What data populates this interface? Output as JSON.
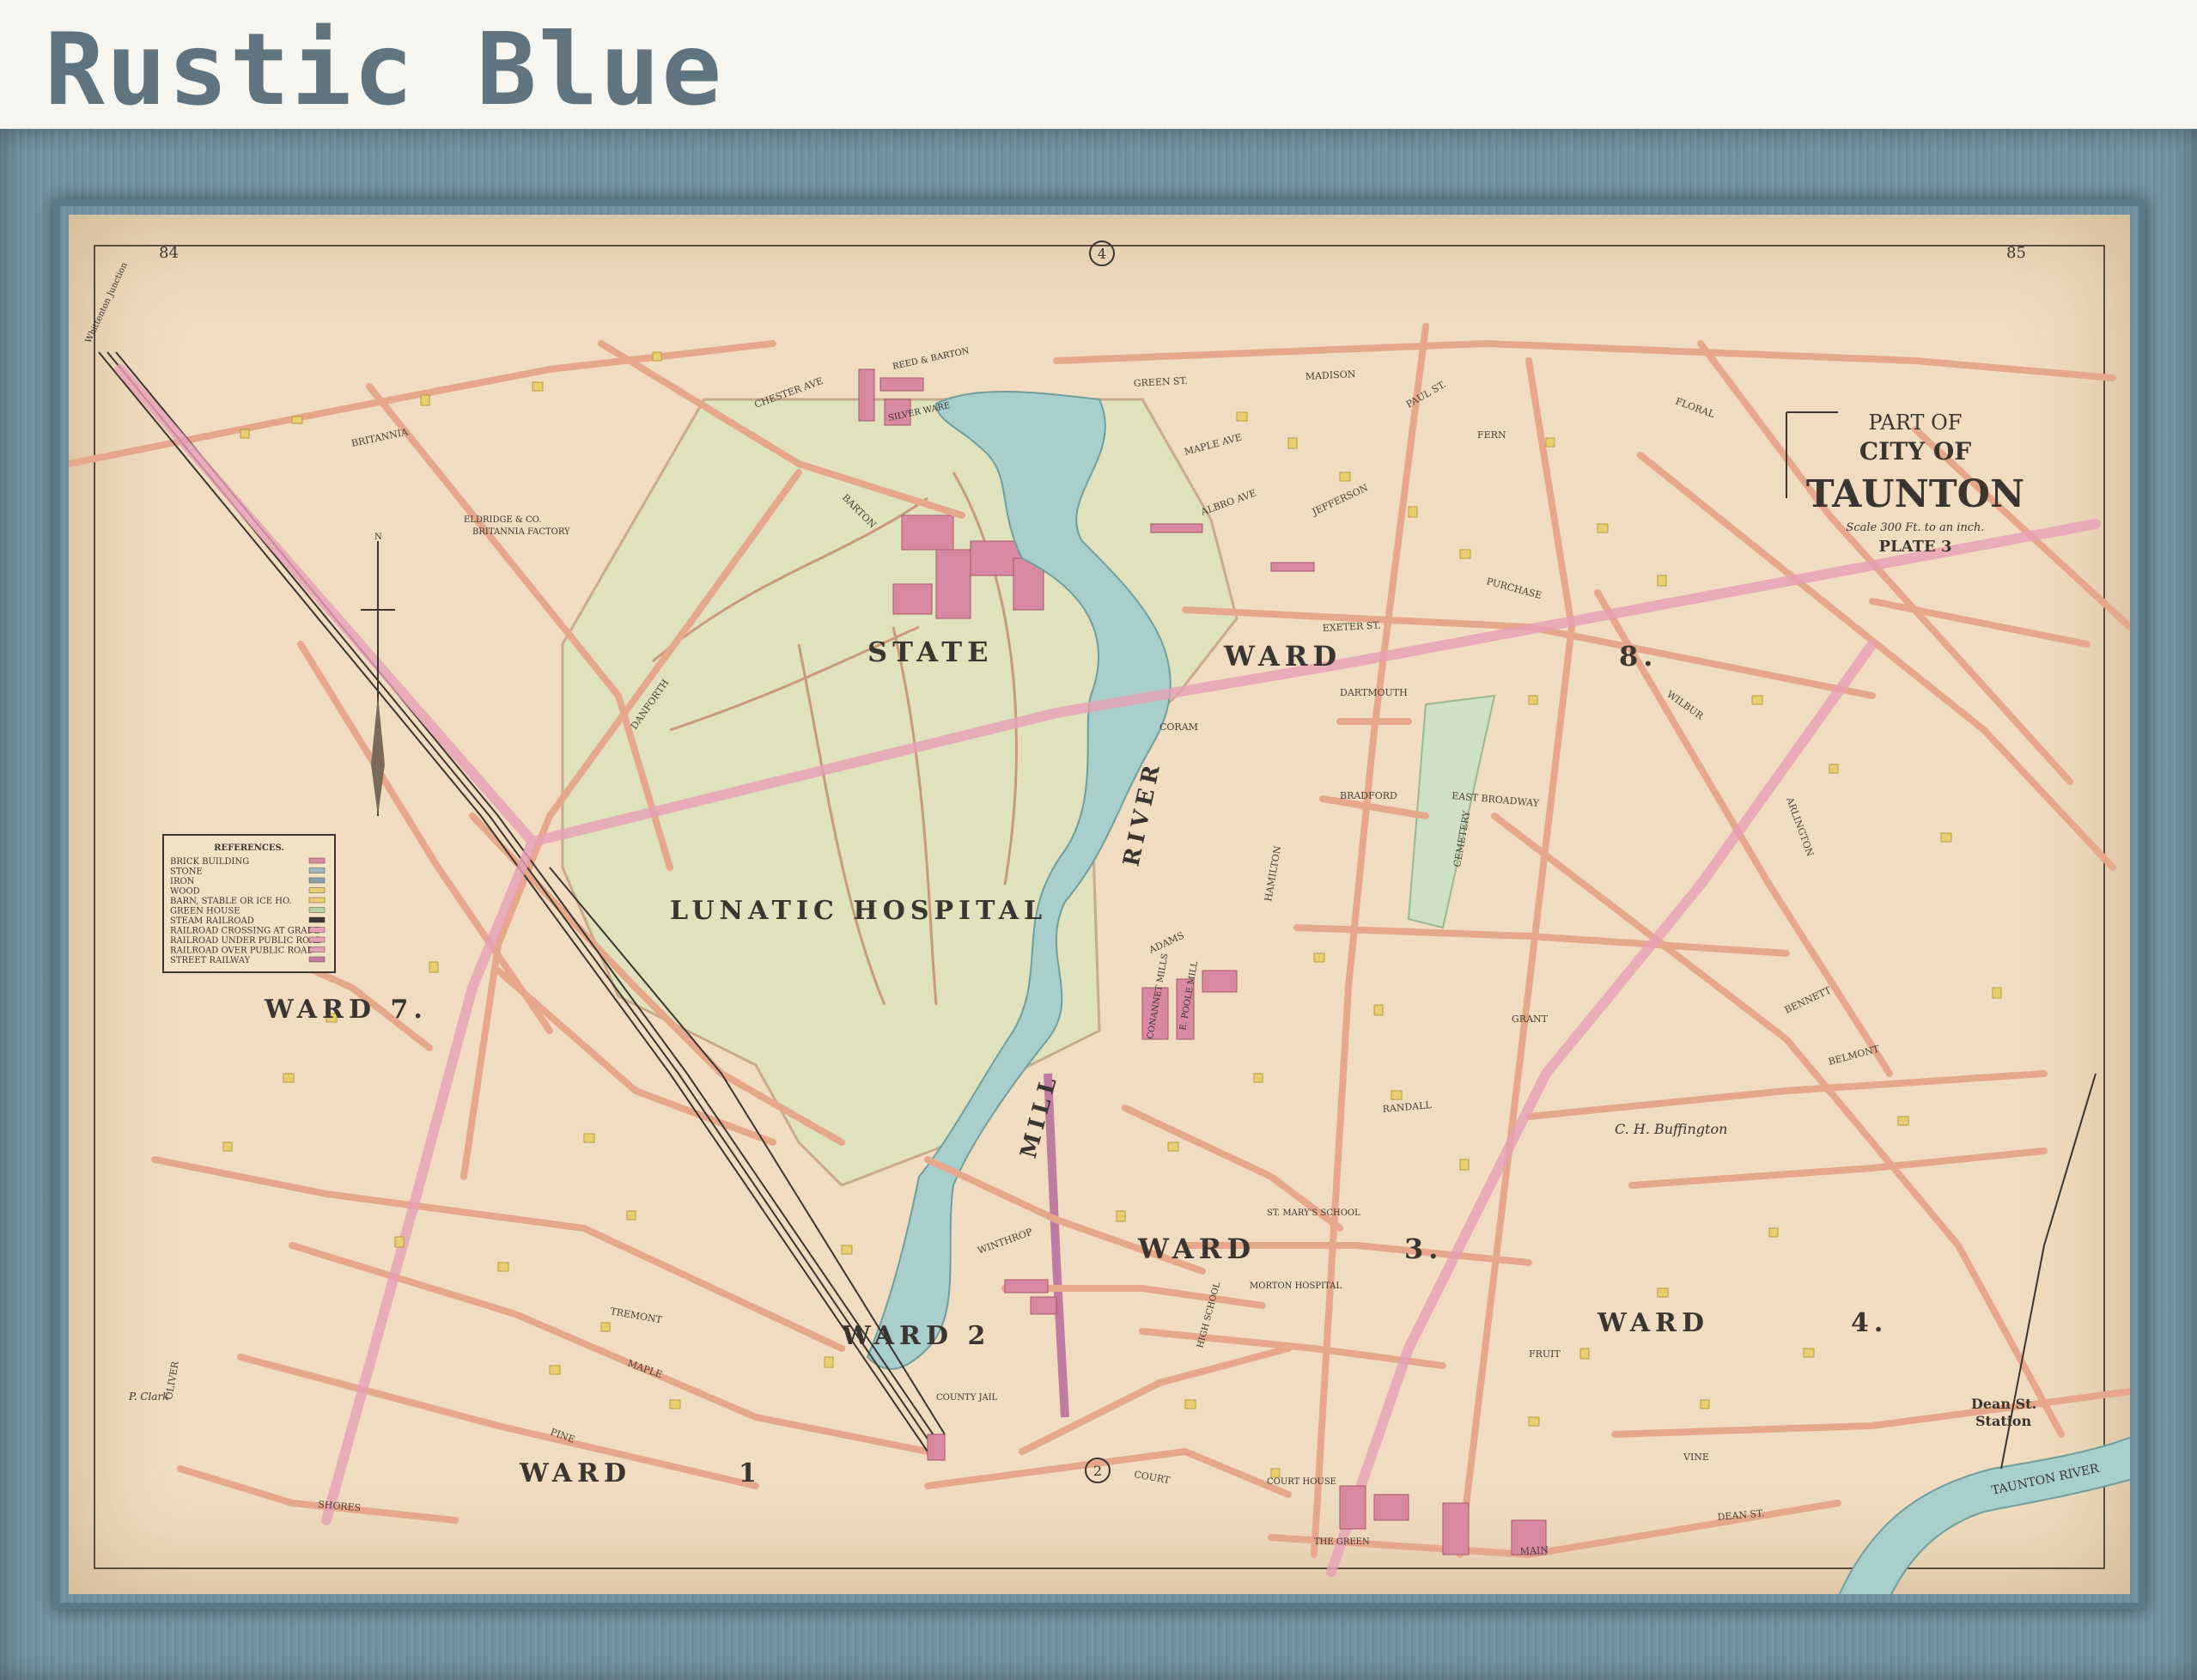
{
  "banner": {
    "title": "Rustic Blue"
  },
  "map": {
    "page_numbers": {
      "left": "84",
      "right": "85"
    },
    "circle_markers": [
      "4",
      "2"
    ],
    "title_block": {
      "part_of": "PART OF",
      "city_of": "CITY OF",
      "city": "TAUNTON",
      "scale": "Scale 300 Ft. to an inch.",
      "plate": "PLATE 3"
    },
    "areas": {
      "state": "STATE",
      "lunatic_hospital": "LUNATIC HOSPITAL",
      "ward_top": "WARD",
      "ward_8": "8.",
      "ward_7": "WARD 7.",
      "ward_3": "WARD",
      "ward_3_num": "3.",
      "ward_4": "WARD",
      "ward_4_num": "4.",
      "ward_2": "WARD 2",
      "ward_1": "WARD",
      "ward_1_num": "1"
    },
    "water": {
      "mill_river_a": "MILL",
      "mill_river_b": "RIVER",
      "taunton_river": "TAUNTON RIVER"
    },
    "references": {
      "title": "REFERENCES.",
      "items": [
        "BRICK BUILDING",
        "STONE",
        "IRON",
        "WOOD",
        "BARN, STABLE OR ICE HO.",
        "GREEN HOUSE",
        "STEAM RAILROAD",
        "RAILROAD CROSSING AT GRADE",
        "RAILROAD UNDER PUBLIC ROAD",
        "RAILROAD OVER PUBLIC ROAD",
        "STREET RAILWAY"
      ]
    },
    "streets": [
      "BRITANNIA",
      "CHESTER AVE",
      "MADISON",
      "GREEN ST.",
      "FLORAL",
      "PAUL ST.",
      "FERN",
      "MAPLE AVE",
      "ALBRO AVE",
      "JEFFERSON",
      "BARTON",
      "DANFORTH",
      "PURCHASE",
      "EXETER ST.",
      "DARTMOUTH",
      "CORAM",
      "BRADFORD",
      "EAST BROADWAY",
      "HAMILTON",
      "ADAMS",
      "GRANT",
      "BENNETT",
      "BELMONT",
      "RANDALL",
      "TREMONT",
      "MAPLE",
      "PINE",
      "SHORES",
      "OLIVER",
      "DEAN ST.",
      "MAIN",
      "COURT",
      "FRUIT",
      "VINE",
      "WINTHROP",
      "ARLINGTON",
      "WILBUR",
      "CEMETERY"
    ],
    "labels": {
      "eldridge": "ELDRIDGE & CO.",
      "britannia_factory": "BRITANNIA FACTORY",
      "reed_barton": "REED & BARTON",
      "silver_ware": "SILVER WARE",
      "whittenton": "Whittenton Junction",
      "buffington": "C. H. Buffington",
      "dean_station_a": "Dean St.",
      "dean_station_b": "Station",
      "county_jail": "COUNTY JAIL",
      "st_marys": "ST. MARY'S SCHOOL",
      "morton_hospital": "MORTON HOSPITAL",
      "high_school": "HIGH SCHOOL",
      "the_green": "THE GREEN",
      "court_house": "COURT HOUSE",
      "p_clark": "P. Clark",
      "poole_mill": "E. POOLE MILL",
      "reid_mill": "CONANNET MILLS"
    }
  }
}
